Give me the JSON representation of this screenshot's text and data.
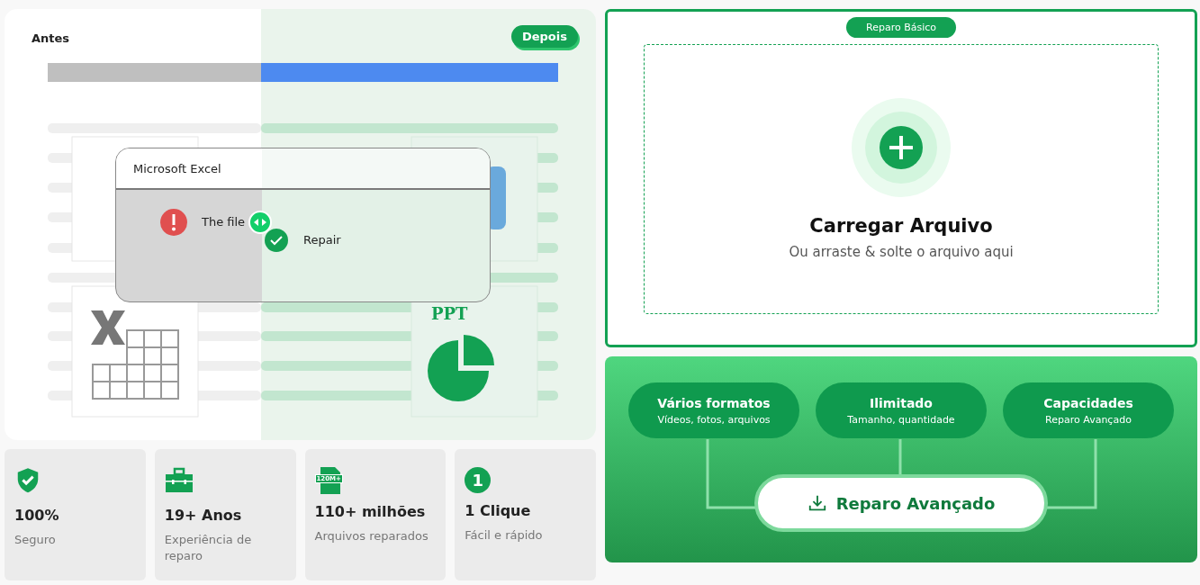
{
  "comparison": {
    "before_label": "Antes",
    "after_label": "Depois",
    "dialog": {
      "title": "Microsoft Excel",
      "error_text": "The file",
      "success_text": "Repair"
    },
    "ppt_label": "PPT"
  },
  "upload": {
    "mode_badge": "Reparo Básico",
    "title": "Carregar Arquivo",
    "subtitle": "Ou arraste & solte o arquivo aqui"
  },
  "features": [
    {
      "title": "Vários formatos",
      "subtitle": "Vídeos, fotos, arquivos"
    },
    {
      "title": "Ilimitado",
      "subtitle": "Tamanho, quantidade"
    },
    {
      "title": "Capacidades",
      "subtitle": "Reparo Avançado"
    }
  ],
  "advanced_button": "Reparo Avançado",
  "stats": [
    {
      "kind": "shield",
      "value": "100%",
      "label": "Seguro"
    },
    {
      "kind": "toolbox",
      "value": "19+ Anos",
      "label": "Experiência de reparo"
    },
    {
      "kind": "file",
      "badge": "120M+",
      "value": "110+ milhões",
      "label": "Arquivos reparados"
    },
    {
      "kind": "number",
      "badge": "1",
      "value": "1 Clique",
      "label": "Fácil e rápido"
    }
  ]
}
